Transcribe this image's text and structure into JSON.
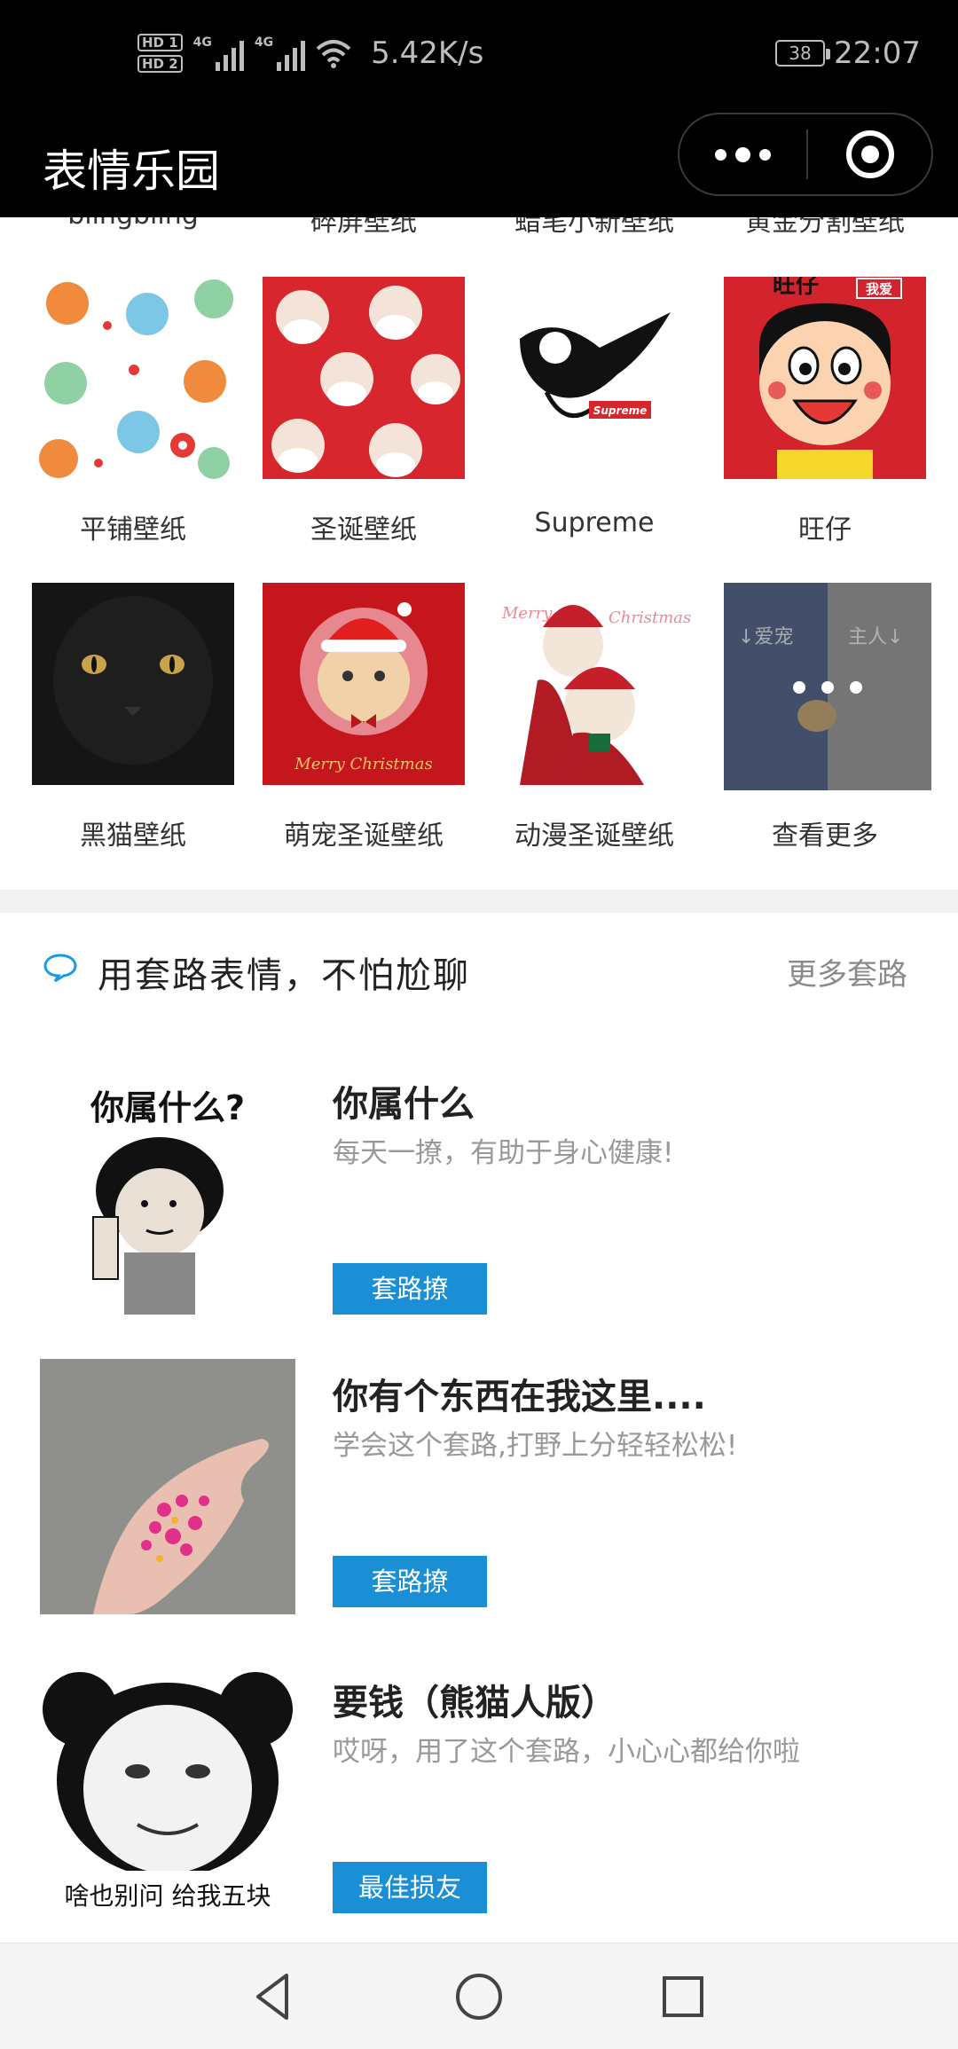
{
  "status_bar": {
    "hd1": "HD 1",
    "hd2": "HD 2",
    "net1": "4G",
    "net2": "4G",
    "speed": "5.42K/s",
    "battery": "38",
    "time": "22:07"
  },
  "nav": {
    "title": "表情乐园"
  },
  "wallpaper_section": {
    "cut_labels": [
      "blingbling",
      "碎屏壁纸",
      "蜡笔小新壁纸",
      "黄金分割壁纸"
    ],
    "tiles": [
      {
        "label": "平铺壁纸"
      },
      {
        "label": "圣诞壁纸"
      },
      {
        "label": "Supreme",
        "logo_text": "Supreme"
      },
      {
        "label": "旺仔",
        "art_text": "旺仔",
        "badge": "我爱"
      },
      {
        "label": "黑猫壁纸"
      },
      {
        "label": "萌宠圣诞壁纸",
        "caption": "Merry Christmas"
      },
      {
        "label": "动漫圣诞壁纸",
        "caption_left": "Merry",
        "caption_right": "Christmas"
      },
      {
        "label": "查看更多",
        "left_text": "↓爱宠",
        "right_text": "主人↓"
      }
    ]
  },
  "routine_section": {
    "title": "用套路表情，不怕尬聊",
    "more": "更多套路",
    "items": [
      {
        "title": "你属什么",
        "desc": "每天一撩，有助于身心健康!",
        "button": "套路撩",
        "image_text": "你属什么?"
      },
      {
        "title": "你有个东西在我这里....",
        "desc": "学会这个套路,打野上分轻轻松松!",
        "button": "套路撩"
      },
      {
        "title": "要钱（熊猫人版）",
        "desc": "哎呀，用了这个套路，小心心都给你啦",
        "button": "最佳损友",
        "image_text": "啥也别问 给我五块"
      }
    ]
  },
  "colors": {
    "accent_button": "#1a8fd6",
    "status_bar_bg": "#000000",
    "section_gap": "#f2f2f2"
  }
}
